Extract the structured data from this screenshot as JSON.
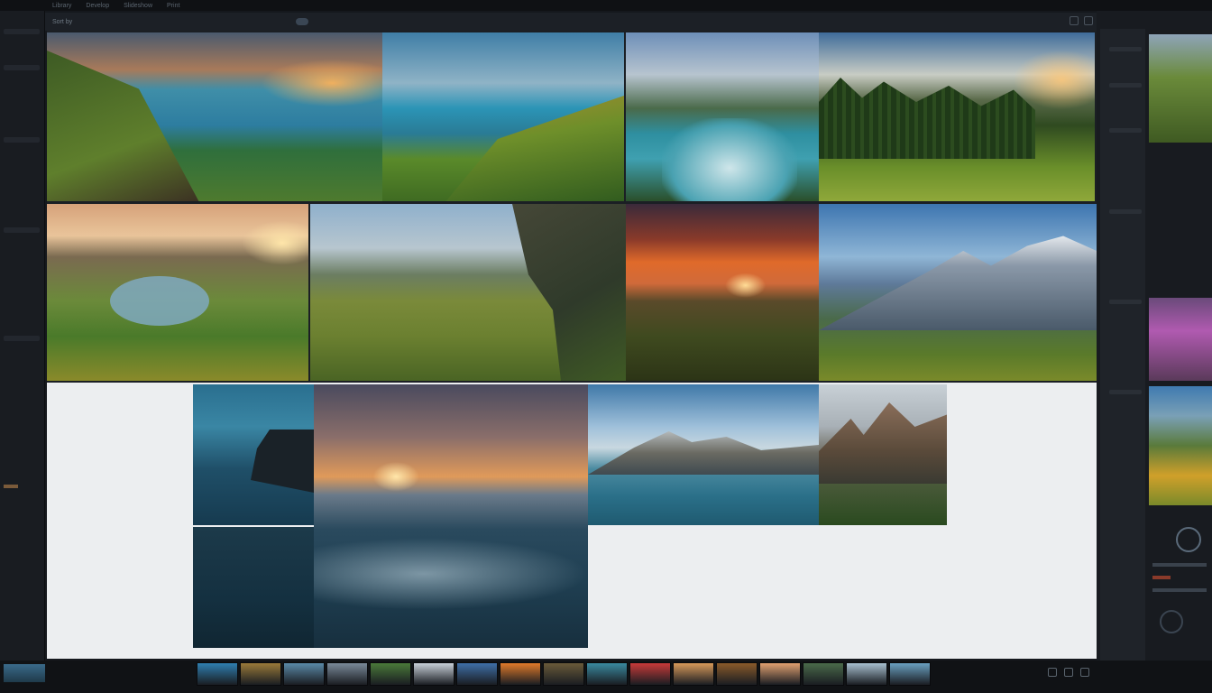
{
  "menubar": {
    "items": [
      "Library",
      "Develop",
      "Slideshow",
      "Print"
    ]
  },
  "toolbar": {
    "label": "Sort by"
  },
  "grid": {
    "photos": [
      {
        "caption": ""
      },
      {
        "caption": ""
      },
      {
        "caption": ""
      },
      {
        "caption": ""
      },
      {
        "caption": ""
      },
      {
        "caption": ""
      },
      {
        "caption": ""
      },
      {
        "caption": ""
      },
      {
        "caption": ""
      },
      {
        "caption": ""
      },
      {
        "caption": ""
      },
      {
        "caption": ""
      },
      {
        "caption": ""
      }
    ]
  },
  "filmstrip": {
    "thumbs": [
      "#2f7fb0",
      "#9a7a3a",
      "#5a8aa8",
      "#7a8a9a",
      "#4a7a3a",
      "#c8d0d8",
      "#3f6fa8",
      "#e07a2a",
      "#6a5a3a",
      "#3a8aa0",
      "#c83a3a",
      "#d89a5a",
      "#8a5a2a",
      "#e0a070",
      "#4a6a4a",
      "#a8c0d0",
      "#6aa0c0"
    ]
  },
  "colors": {
    "background": "#15181d",
    "canvas": "#eceef0",
    "panel": "#181b20"
  }
}
